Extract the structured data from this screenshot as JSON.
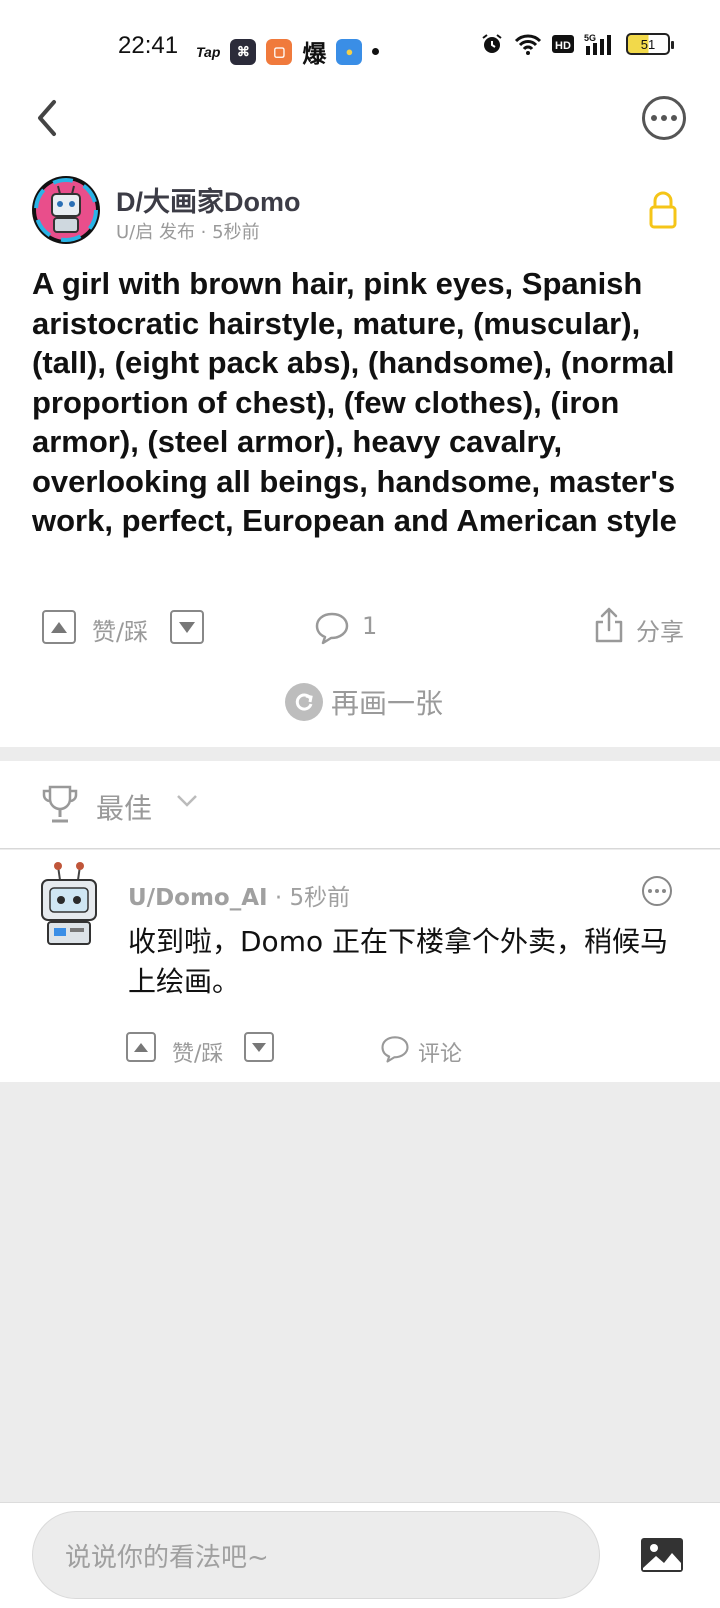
{
  "status": {
    "time": "22:41",
    "battery": "51",
    "apps": [
      "Tap",
      "",
      "",
      "爆",
      ""
    ]
  },
  "post": {
    "author": "D/大画家Domo",
    "meta": "U/启 发布 · 5秒前",
    "prompt": "A girl with brown hair, pink eyes, Spanish aristocratic hairstyle, mature, (muscular), (tall), (eight pack abs), (handsome), (normal proportion of chest), (few clothes), (iron armor), (steel armor), heavy cavalry, overlooking all beings, handsome, master's work, perfect, European and American style",
    "vote_label": "赞/踩",
    "comment_count": "1",
    "share_label": "分享",
    "redraw_label": "再画一张"
  },
  "sort": {
    "label": "最佳"
  },
  "comment": {
    "user": "U/Domo_AI",
    "time": " · 5秒前",
    "text": "收到啦，Domo 正在下楼拿个外卖，稍候马上绘画。",
    "vote_label": "赞/踩",
    "reply_label": "评论"
  },
  "composer": {
    "placeholder": "说说你的看法吧~"
  },
  "colors": {
    "lock": "#f5c518",
    "muted": "#9a9a9a",
    "background": "#ececec"
  }
}
